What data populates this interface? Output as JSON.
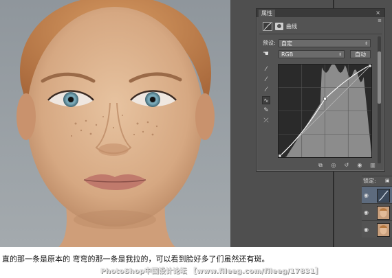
{
  "panel": {
    "tab_title": "属性",
    "close_glyph": "×",
    "menu_glyph": "≡",
    "adjustment_title": "曲线",
    "preset_label": "预设:",
    "preset_value": "自定",
    "channel_value": "RGB",
    "auto_button": "自动",
    "tools": [
      "sample-in-image-icon",
      "sample-black-icon",
      "sample-white-icon",
      "curve-pen-icon",
      "pencil-icon",
      "smooth-icon"
    ],
    "footer_icons": [
      "clip-to-layer-icon",
      "view-previous-icon",
      "reset-icon",
      "visibility-icon",
      "trash-icon"
    ]
  },
  "curves": {
    "points": [
      [
        0,
        0
      ],
      [
        0.5,
        0.63
      ],
      [
        1,
        1
      ]
    ],
    "input_min": 0,
    "input_max": 255
  },
  "layers": {
    "lock_label": "锁定:",
    "rows": [
      {
        "kind": "adjustment",
        "selected": true
      },
      {
        "kind": "photo",
        "selected": false
      },
      {
        "kind": "photo",
        "selected": false
      }
    ]
  },
  "caption": "直的那一条是原本的 弯弯的那一条是我拉的，可以看到脸好多了们虽然还有斑。",
  "watermark": "PhotoShop中国设计论坛 【www.fileeg.com/fileeg/17831】",
  "colors": {
    "panel_bg": "#535353",
    "graph_bg": "#2a2a2a",
    "histogram": "#8c8c8c",
    "selected_layer": "#5d6b7e"
  }
}
